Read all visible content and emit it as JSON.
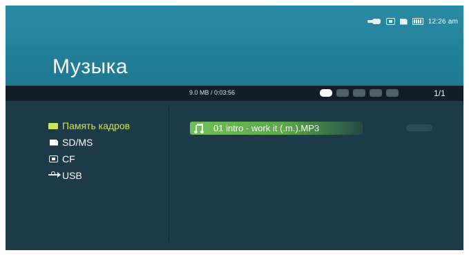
{
  "status_bar": {
    "icons": [
      "link-icon",
      "cf-card-icon",
      "sd-card-icon",
      "battery-icon"
    ],
    "time": "12:26 am"
  },
  "header": {
    "title": "Музыка"
  },
  "info_bar": {
    "size_duration": "9.0 MB / 0:03:56",
    "play_modes": [
      "repeat-all-icon",
      "repeat-one-icon",
      "shuffle-icon",
      "shuffle-repeat-icon",
      "repeat-off-icon"
    ],
    "active_mode": "repeat-all-icon",
    "page": "1/1"
  },
  "sources": [
    {
      "label": "Память кадров",
      "icon": "memory-icon",
      "selected": true
    },
    {
      "label": "SD/MS",
      "icon": "sd-card-icon",
      "selected": false
    },
    {
      "label": "CF",
      "icon": "cf-card-icon",
      "selected": false
    },
    {
      "label": "USB",
      "icon": "usb-icon",
      "selected": false
    }
  ],
  "files": [
    {
      "name": "01 intro - work it (.m.).MP3",
      "icon": "music-note-icon",
      "selected": true
    }
  ],
  "colors": {
    "header": "#2a8ba5",
    "body": "#1c3a48",
    "info_bar": "#101f27",
    "selected_text": "#c8e85a",
    "selected_file": "#6fbf56"
  }
}
